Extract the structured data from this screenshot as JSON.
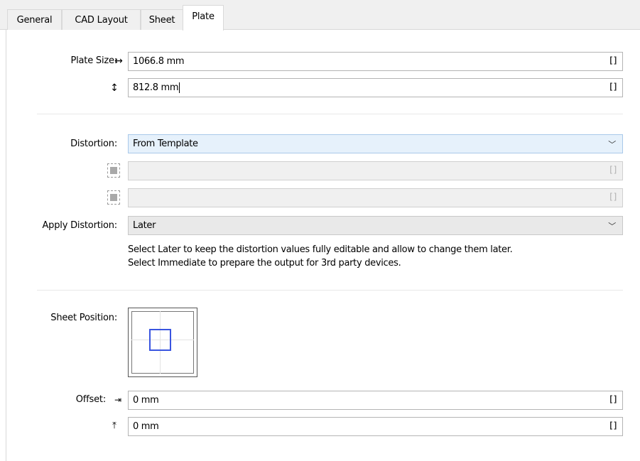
{
  "tabs": [
    {
      "label": "General",
      "active": false
    },
    {
      "label": "CAD Layout",
      "active": false
    },
    {
      "label": "Sheet",
      "active": false
    },
    {
      "label": "Plate",
      "active": true
    }
  ],
  "plate_size": {
    "label": "Plate Size:",
    "width_icon": "horizontal-arrows-icon",
    "height_icon": "vertical-arrows-icon",
    "width_value": "1066.8 mm",
    "height_value": "812.8 mm",
    "unit_button": "[]"
  },
  "distortion": {
    "label": "Distortion:",
    "selected": "From Template",
    "horizontal_value": "",
    "vertical_value": "",
    "unit_button": "[]"
  },
  "apply_distortion": {
    "label": "Apply Distortion:",
    "selected": "Later",
    "help_line1": "Select Later to keep the distortion values fully editable and allow to change them later.",
    "help_line2": "Select Immediate to prepare the output for 3rd party devices."
  },
  "sheet_position": {
    "label": "Sheet Position:"
  },
  "offset": {
    "label": "Offset:",
    "x_icon": "offset-x-icon",
    "y_icon": "offset-y-icon",
    "x_value": "0 mm",
    "y_value": "0 mm",
    "unit_button": "[]"
  },
  "colors": {
    "accent_blue": "#3a55e0",
    "combo_highlight": "#e6f1fb"
  }
}
